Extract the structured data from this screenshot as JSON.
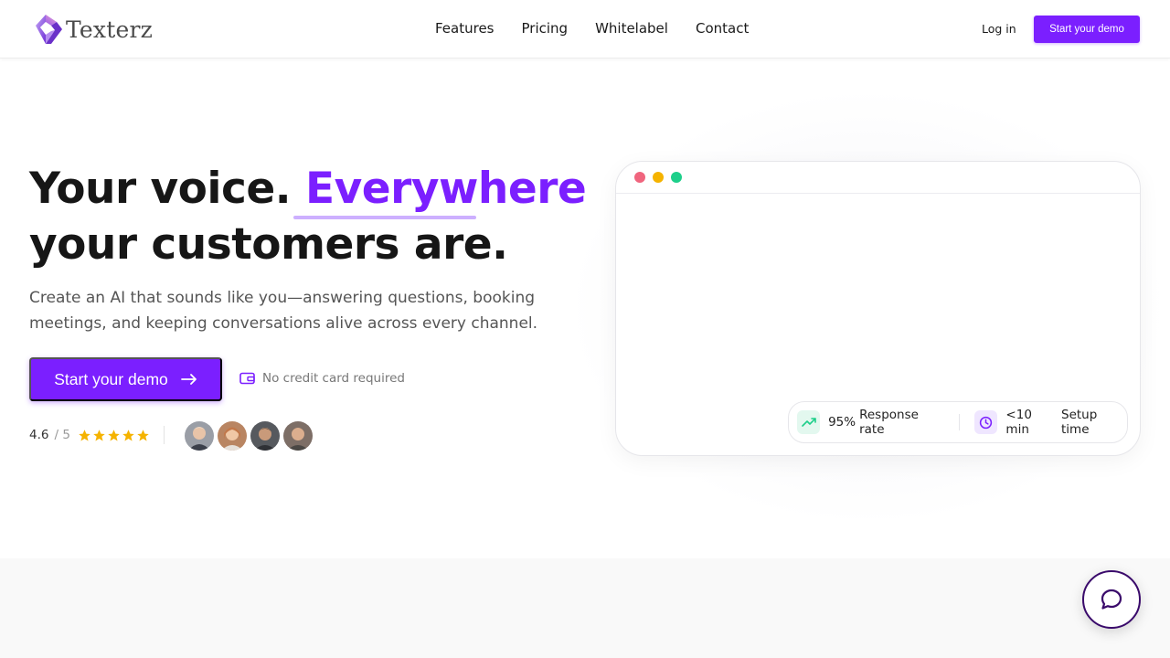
{
  "brand": {
    "name": "Texterz",
    "accent": "#7b1fff"
  },
  "nav": {
    "links": [
      "Features",
      "Pricing",
      "Whitelabel",
      "Contact"
    ],
    "login": "Log in",
    "cta": "Start your demo"
  },
  "hero": {
    "headline_part1": "Your voice.",
    "headline_accent": "Everywhere",
    "headline_part2": "your customers are.",
    "subtext": "Create an AI that sounds like you—answering questions, booking meetings, and keeping conversations alive across every channel.",
    "cta": "Start your demo",
    "no_credit": "No credit card required",
    "rating_score": "4.6",
    "rating_outof": "/ 5",
    "stars": 5
  },
  "window": {
    "dots": [
      "#f0657e",
      "#f5b300",
      "#1dcf8a"
    ],
    "stats": [
      {
        "icon": "trending-up-icon",
        "value": "95%",
        "label": "Response rate",
        "color": "#1dcf8a"
      },
      {
        "icon": "clock-icon",
        "value": "<10 min",
        "label": "Setup time",
        "color": "#7b1fff"
      }
    ]
  },
  "chat_fab": {
    "icon": "chat-bubble-icon"
  }
}
